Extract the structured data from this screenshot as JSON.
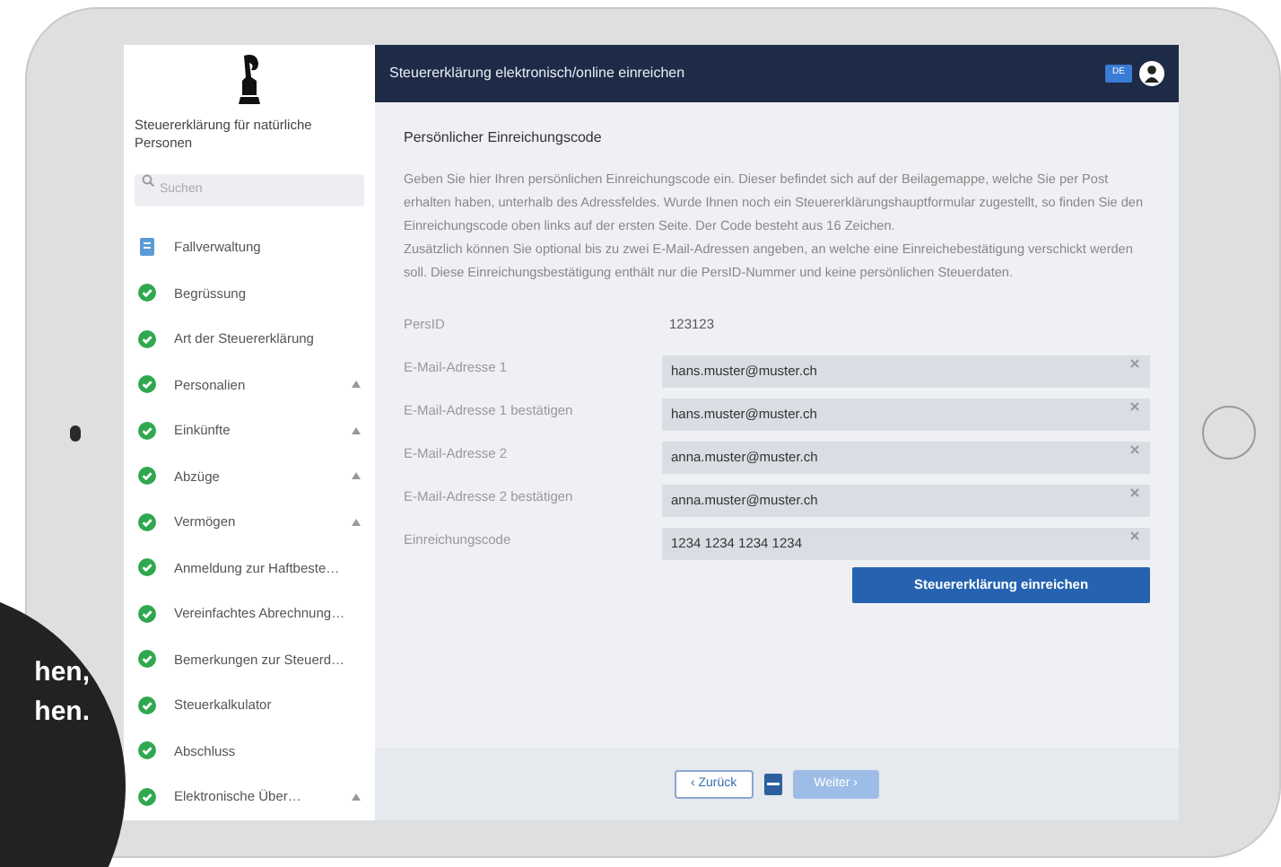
{
  "sidebar": {
    "title": "Steuererklärung für natürliche Personen",
    "search": {
      "placeholder": "Suchen"
    },
    "items": [
      {
        "label": "Fallverwaltung",
        "kind": "document",
        "has_children": false
      },
      {
        "label": "Begrüssung",
        "kind": "done",
        "has_children": false
      },
      {
        "label": "Art der Steuererklärung",
        "kind": "done",
        "has_children": false
      },
      {
        "label": "Personalien",
        "kind": "done",
        "has_children": true
      },
      {
        "label": "Einkünfte",
        "kind": "done",
        "has_children": true
      },
      {
        "label": "Abzüge",
        "kind": "done",
        "has_children": true
      },
      {
        "label": "Vermögen",
        "kind": "done",
        "has_children": true
      },
      {
        "label": "Anmeldung zur Haftbeste…",
        "kind": "done",
        "has_children": false
      },
      {
        "label": "Vereinfachtes Abrechnung…",
        "kind": "done",
        "has_children": false
      },
      {
        "label": "Bemerkungen zur Steuerd…",
        "kind": "done",
        "has_children": false
      },
      {
        "label": "Steuerkalkulator",
        "kind": "done",
        "has_children": false
      },
      {
        "label": "Abschluss",
        "kind": "done",
        "has_children": false
      },
      {
        "label": "Elektronische Über…",
        "kind": "done",
        "has_children": true
      }
    ]
  },
  "header": {
    "title": "Steuererklärung elektronisch/online einreichen",
    "language": "DE"
  },
  "content": {
    "heading": "Persönlicher Einreichungscode",
    "paragraphs": [
      "Geben Sie hier Ihren persönlichen Einreichungscode ein. Dieser befindet sich auf der Beilagemappe, welche Sie per Post erhalten haben, unterhalb des Adressfeldes. Wurde Ihnen noch ein Steuererklärungshauptformular zugestellt, so finden Sie den Einreichungscode oben links auf der ersten Seite. Der Code besteht aus 16 Zeichen.",
      "Zusätzlich können Sie optional bis zu zwei E-Mail-Adressen angeben, an welche eine Einreichebestätigung verschickt werden soll. Diese Einreichungsbestätigung enthält nur die PersID-Nummer und keine persönlichen Steuerdaten."
    ],
    "fields": [
      {
        "label": "PersID",
        "value": "123123",
        "kind": "readonly"
      },
      {
        "label": "E-Mail-Adresse 1",
        "value": "hans.muster@muster.ch",
        "kind": "input"
      },
      {
        "label": "E-Mail-Adresse 1 bestätigen",
        "value": "hans.muster@muster.ch",
        "kind": "input"
      },
      {
        "label": "E-Mail-Adresse 2",
        "value": "anna.muster@muster.ch",
        "kind": "input"
      },
      {
        "label": "E-Mail-Adresse 2 bestätigen",
        "value": "anna.muster@muster.ch",
        "kind": "input"
      },
      {
        "label": "Einreichungscode",
        "value": "1234 1234 1234 1234",
        "kind": "input"
      }
    ],
    "submit_button": "Steuererklärung einreichen"
  },
  "footer": {
    "back_button": {
      "label": "‹ Zurück",
      "disabled": false
    },
    "next_button": {
      "label": "Weiter ›",
      "disabled": true
    }
  },
  "overlay_badge": {
    "lines": [
      "hen,",
      "hen."
    ]
  }
}
